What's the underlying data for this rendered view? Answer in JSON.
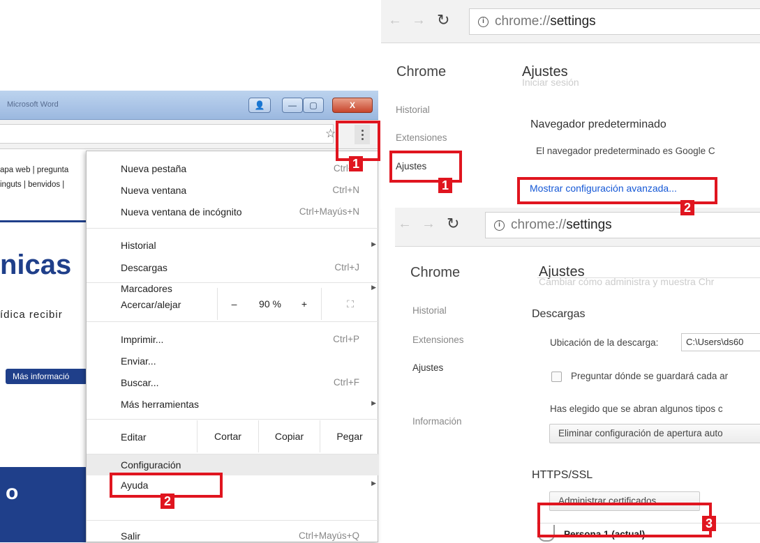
{
  "left_window": {
    "title": "Microsoft Word",
    "buttons": {
      "user": "👤",
      "minimize": "—",
      "maximize": "▢",
      "close": "X"
    },
    "page_links": [
      "apa web  | pregunta",
      "inguts | benvidos |"
    ],
    "page_heading": "nicas",
    "page_text": "ídica recibir",
    "page_button": "Más informació",
    "page_band_text": "o"
  },
  "chrome_menu": {
    "new_tab": {
      "label": "Nueva pestaña",
      "shortcut": "Ctrl+T"
    },
    "new_window": {
      "label": "Nueva ventana",
      "shortcut": "Ctrl+N"
    },
    "incognito": {
      "label": "Nueva ventana de incógnito",
      "shortcut": "Ctrl+Mayús+N"
    },
    "history": {
      "label": "Historial"
    },
    "downloads": {
      "label": "Descargas",
      "shortcut": "Ctrl+J"
    },
    "bookmarks": {
      "label": "Marcadores"
    },
    "zoom": {
      "label": "Acercar/alejar",
      "minus": "–",
      "value": "90 %",
      "plus": "+",
      "fullscreen": "⛶"
    },
    "print": {
      "label": "Imprimir...",
      "shortcut": "Ctrl+P"
    },
    "cast": {
      "label": "Enviar..."
    },
    "find": {
      "label": "Buscar...",
      "shortcut": "Ctrl+F"
    },
    "more_tools": {
      "label": "Más herramientas"
    },
    "edit": {
      "label": "Editar",
      "cut": "Cortar",
      "copy": "Copiar",
      "paste": "Pegar"
    },
    "settings": {
      "label": "Configuración"
    },
    "help": {
      "label": "Ayuda"
    },
    "exit": {
      "label": "Salir",
      "shortcut": "Ctrl+Mayús+Q"
    }
  },
  "settings_top": {
    "url_prefix": "chrome://",
    "url_path": "settings",
    "brand": "Chrome",
    "title": "Ajustes",
    "ghost_text": "Iniciar sesión",
    "sidebar": [
      "Historial",
      "Extensiones",
      "Ajustes"
    ],
    "default_browser_heading": "Navegador predeterminado",
    "default_browser_text": "El navegador predeterminado es Google C",
    "advanced_link": "Mostrar configuración avanzada..."
  },
  "settings_bottom": {
    "url_prefix": "chrome://",
    "url_path": "settings",
    "brand": "Chrome",
    "title": "Ajustes",
    "ghost_text": "Cambiar cómo administra y muestra Chr",
    "sidebar": [
      "Historial",
      "Extensiones",
      "Ajustes",
      "Información"
    ],
    "downloads_heading": "Descargas",
    "download_location_label": "Ubicación de la descarga:",
    "download_location_value": "C:\\Users\\ds60",
    "ask_where_label": "Preguntar dónde se guardará cada ar",
    "auto_open_text": "Has elegido que se abran algunos tipos c",
    "clear_auto_open_button": "Eliminar configuración de apertura auto",
    "https_heading": "HTTPS/SSL",
    "manage_certs_button": "Administrar certificados...",
    "person_label": "Persona 1 (actual)"
  },
  "callouts": [
    "1",
    "2",
    "1",
    "2",
    "3"
  ],
  "colors": {
    "callout_red": "#e0151f",
    "link_blue": "#1558d6",
    "page_blue": "#1f3f8a"
  }
}
